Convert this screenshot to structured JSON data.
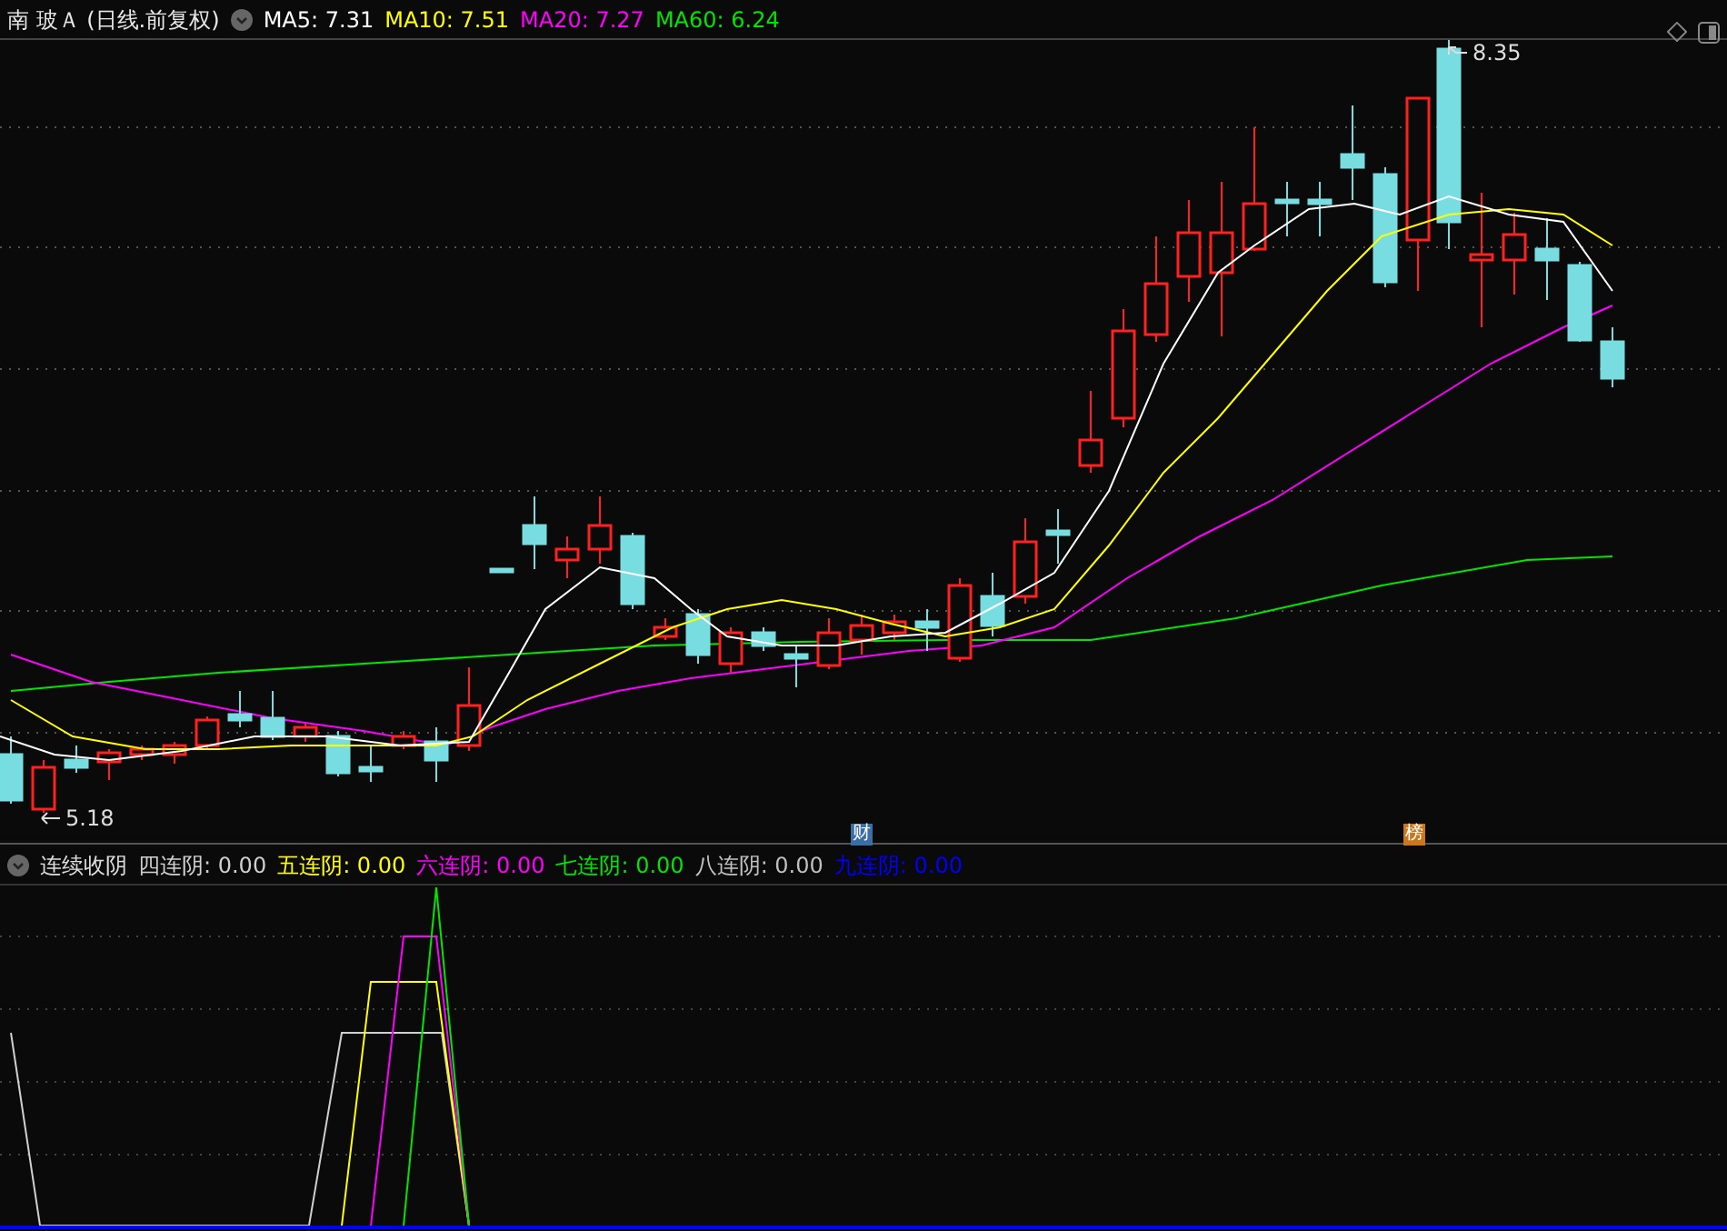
{
  "title": "南 玻Ａ (日线.前复权)",
  "ma_legend": [
    {
      "label": "MA5: 7.31",
      "color": "#ffffff"
    },
    {
      "label": "MA10: 7.51",
      "color": "#ffff00"
    },
    {
      "label": "MA20: 7.27",
      "color": "#ff00ff"
    },
    {
      "label": "MA60: 6.24",
      "color": "#00e600"
    }
  ],
  "price_chart": {
    "high_label": "8.35",
    "low_label": "5.18",
    "markers": [
      {
        "text": "财",
        "color": "#3a6ea5"
      },
      {
        "text": "榜",
        "color": "#c8781e"
      }
    ]
  },
  "indicator": {
    "name": "连续收阴",
    "legend": [
      {
        "label": "四连阴: 0.00",
        "color": "#d0d0d0"
      },
      {
        "label": "五连阴: 0.00",
        "color": "#ffff00"
      },
      {
        "label": "六连阴: 0.00",
        "color": "#ff00ff"
      },
      {
        "label": "七连阴: 0.00",
        "color": "#00e600"
      },
      {
        "label": "八连阴: 0.00",
        "color": "#c0c0c0"
      },
      {
        "label": "九连阴: 0.00",
        "color": "#0000ff"
      }
    ]
  }
}
